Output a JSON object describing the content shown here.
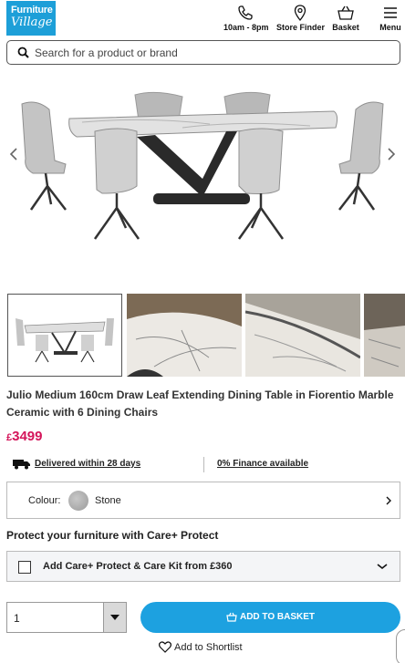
{
  "brand": {
    "line1": "Furniture",
    "line2": "Village"
  },
  "header": {
    "hours_label": "10am - 8pm",
    "store_label": "Store Finder",
    "basket_label": "Basket",
    "menu_label": "Menu"
  },
  "search": {
    "placeholder": "Search for a product or brand"
  },
  "product": {
    "title": "Julio Medium 160cm Draw Leaf Extending Dining Table in Fiorentio Marble Ceramic with 6 Dining Chairs",
    "currency": "£",
    "price": "3499"
  },
  "delivery": {
    "text": "Delivered within 28 days",
    "finance": "0% Finance available"
  },
  "colour": {
    "label": "Colour:",
    "value": "Stone",
    "swatch": "#b0b0b0"
  },
  "care": {
    "heading": "Protect your furniture with Care+ Protect",
    "option": "Add Care+ Protect & Care Kit from £360"
  },
  "purchase": {
    "quantity": "1",
    "add_label": "ADD TO BASKET",
    "shortlist_label": "Add to Shortlist"
  },
  "colors": {
    "brand_blue": "#1da1e0",
    "price_pink": "#d4145a"
  }
}
